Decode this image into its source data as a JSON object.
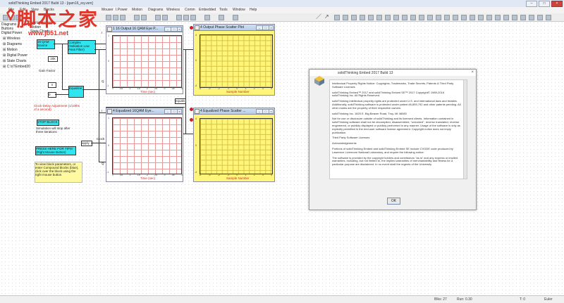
{
  "window": {
    "title": "solidThinking Embed 2017 Build 13 - [qam16_eq.vsm]",
    "buttons": [
      "–",
      "□",
      "×"
    ]
  },
  "menu": [
    "File",
    "Edit",
    "View",
    "Blocks",
    "Mouser",
    "I.Power",
    "Motion",
    "Diagrams",
    "Wireless",
    "Comm",
    "Embedded",
    "Tools",
    "Window",
    "Help"
  ],
  "tree": {
    "header": [
      "Diagrams",
      "Motion",
      "State Charts"
    ],
    "items": [
      "Diagrams",
      "Buttons",
      "Digital Power",
      "Wireless",
      "Diagrams",
      "Motion",
      "Digital Power",
      "State Charts",
      "C:\\sTEmbed20"
    ]
  },
  "diagram": {
    "qam_source": "16 QAM Source",
    "filter": "Complex (Nokiation Low Pass Filter)",
    "gain_factor": "Gain Factor",
    "equalizer": "Equalizer",
    "clock_delay": "Clock Delay Adjustment (1/10ths of a second)",
    "stop_block": "STOP BLOCK",
    "stop_note": "Simulation will stop after three iterations",
    "tips_button": "PRESS HERE FOR TIPS! (Right Mouse Button)",
    "tips_note": "To view block parameters, or enter Compound blocks (blue), click over the block using the right mouse button.",
    "signal_i": "I",
    "signal_q": "Q",
    "clock": "Clock",
    "small_labels": [
      "20k",
      "n",
      "rate",
      "apply",
      "equals",
      "sgn",
      "0"
    ]
  },
  "plots": {
    "output_eye": {
      "num": "1",
      "title": "16 Output 16 QAM Eye P...",
      "xlabel": "Time (sec)",
      "xticks": [
        "0",
        ".05",
        ".1",
        ".15",
        ".2",
        ".25",
        ".3",
        ".35",
        ".4"
      ],
      "yticks": [
        "1",
        ".5",
        "0",
        "-.5",
        "-1"
      ]
    },
    "output_scatter": {
      "num": "4",
      "title": "Output Phase Scatter Plot",
      "xlabel": "Sample Number",
      "xticks": [
        "-4",
        "-3",
        "-2",
        "-1",
        "0",
        "1",
        "2",
        "3",
        "4"
      ],
      "yticks": [
        "4",
        "2",
        "0",
        "-2",
        "-4"
      ]
    },
    "eq_eye": {
      "num": "4",
      "title": "Equalized 16QAM Eye...",
      "xlabel": "Time (sec)",
      "xticks": [
        "0",
        ".05",
        ".1",
        ".15",
        ".2",
        ".25",
        ".3",
        ".35",
        ".4"
      ],
      "yticks": [
        "1",
        ".5",
        "0",
        "-.5",
        "-1"
      ]
    },
    "eq_scatter": {
      "num": "4",
      "title": "Equalized Phase Scatter ...",
      "xlabel": "Sample Number",
      "xticks": [
        "-4",
        "-3",
        "-2",
        "-1",
        "0",
        "1",
        "2",
        "3",
        "4"
      ],
      "yticks": [
        "4",
        "2",
        "0",
        "-2",
        "-4"
      ]
    }
  },
  "about": {
    "title": "solidThinking Embed 2017 Build 13",
    "close": "×",
    "paragraphs": [
      "Intellectual Property Rights Notice: Copyrights, Trademarks, Trade Secrets, Patents & Third Party Software Licenses",
      "solidThinking Embed™ 2017 and solidThinking Embed SE™ 2017 Copyright© 1989-2016 solidThinking Inc. All Rights Reserved.",
      "solidThinking intellectual property rights are protected under U.S. and international laws and treaties. Additionally, solidThinking software is protected under patent #6,859,792 and other patents pending. All other marks are the property of their respective owners.",
      "solidThinking Inc. 1820 E. Big Beaver Road, Troy, MI 48083",
      "Not for use or disclosure outside of solidThinking and its licensed clients. Information contained in solidThinking software shall not be decompiled, disassembled, \"unlocked\", reverse translated, reverse engineered, or publicly displayed or publicly performed in any manner. Usage of the software is only as explicitly permitted in the end-user software license agreement. Copyright notice does not imply publication.",
      "Third Party Software Licenses",
      "Acknowledgements",
      "Portions of solidThinking Embed and solidThinking Embed SE include CVODE code produced by Lawrence Livermore National Laboratory, and require the following notice:",
      "The software is provided by the copyright holders and contributors \"as is\" and any express or implied warranties, including, but not limited to, the implied warranties of merchantability and fitness for a particular purpose are disclaimed. In no event shall the regents of the University"
    ],
    "ok": "OK"
  },
  "status": {
    "blks": "Blks: 27",
    "run": "Run: 0.30",
    "time": "T: 0",
    "solver": "Euler"
  },
  "watermark": {
    "text": "脚本之家",
    "url": "www.jb51.net"
  },
  "colors": {
    "block_cyan": "#2ee6ef",
    "plot_yellow": "#fff57a",
    "wire_red": "#d0231a"
  }
}
